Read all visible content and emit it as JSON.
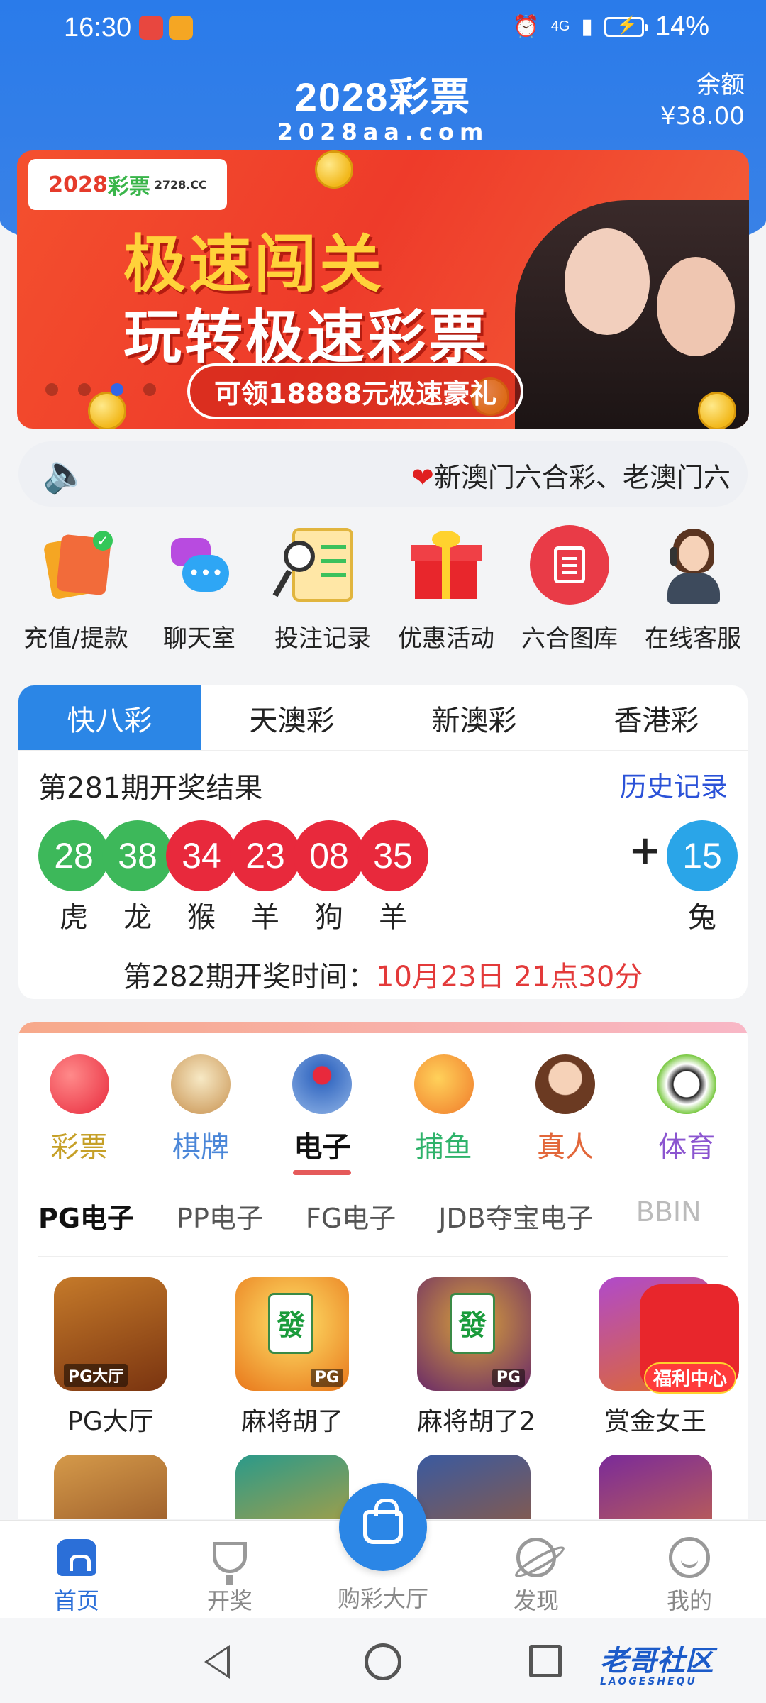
{
  "status_bar": {
    "time": "16:30",
    "network": "4G",
    "battery": "14%"
  },
  "header": {
    "logo": "2028彩票",
    "logo_domain": "2028aa.com",
    "balance_label": "余额",
    "balance_value": "¥38.00"
  },
  "banner": {
    "brand_a": "2028",
    "brand_b": "彩票",
    "brand_domain": "2728.CC",
    "title_line1": "极速闯关",
    "title_line2": "玩转极速彩票",
    "pill": "可领18888元极速豪礼",
    "active_slide": 2,
    "slide_count": 4
  },
  "notice": {
    "icon": "speaker-icon",
    "text": "新澳门六合彩、老澳门六"
  },
  "quick_actions": [
    {
      "label": "充值/提款",
      "icon": "wallet-cards-icon"
    },
    {
      "label": "聊天室",
      "icon": "chat-bubbles-icon"
    },
    {
      "label": "投注记录",
      "icon": "clipboard-search-icon"
    },
    {
      "label": "优惠活动",
      "icon": "gift-box-icon"
    },
    {
      "label": "六合图库",
      "icon": "document-icon"
    },
    {
      "label": "在线客服",
      "icon": "customer-service-icon"
    }
  ],
  "results": {
    "tabs": [
      "快八彩",
      "天澳彩",
      "新澳彩",
      "香港彩"
    ],
    "active_tab": 0,
    "title": "第281期开奖结果",
    "history_link": "历史记录",
    "balls": [
      {
        "number": "28",
        "zodiac": "虎",
        "color": "green"
      },
      {
        "number": "38",
        "zodiac": "龙",
        "color": "green"
      },
      {
        "number": "34",
        "zodiac": "猴",
        "color": "red"
      },
      {
        "number": "23",
        "zodiac": "羊",
        "color": "red"
      },
      {
        "number": "08",
        "zodiac": "狗",
        "color": "red"
      },
      {
        "number": "35",
        "zodiac": "羊",
        "color": "red"
      }
    ],
    "plus": "+",
    "special_ball": {
      "number": "15",
      "zodiac": "兔",
      "color": "blue"
    },
    "next_draw_label": "第282期开奖时间：",
    "next_draw_time": "10月23日 21点30分"
  },
  "games": {
    "categories": [
      {
        "label": "彩票",
        "color": "#c6a028",
        "icon": "lottery-ball-icon"
      },
      {
        "label": "棋牌",
        "color": "#4a86d8",
        "icon": "cards-icon"
      },
      {
        "label": "电子",
        "color": "#111111",
        "icon": "joystick-icon"
      },
      {
        "label": "捕鱼",
        "color": "#2fb36b",
        "icon": "fish-icon"
      },
      {
        "label": "真人",
        "color": "#e2673a",
        "icon": "dealer-icon"
      },
      {
        "label": "体育",
        "color": "#8b55d0",
        "icon": "soccer-ball-icon"
      }
    ],
    "active_category": 2,
    "subtabs": [
      "PG电子",
      "PP电子",
      "FG电子",
      "JDB夺宝电子",
      "BBIN"
    ],
    "active_subtab": 0,
    "tiles": [
      {
        "label": "PG大厅",
        "tag": "PG大厅"
      },
      {
        "label": "麻将胡了",
        "tag": "PG",
        "glyph": "發"
      },
      {
        "label": "麻将胡了2",
        "tag": "PG",
        "glyph": "發"
      },
      {
        "label": "赏金女王"
      }
    ],
    "welfare_label": "福利中心"
  },
  "bottom_nav": {
    "items": [
      "首页",
      "开奖",
      "发现",
      "我的"
    ],
    "center_label": "购彩大厅",
    "active": 0
  },
  "watermark": {
    "text": "老哥社区",
    "sub": "LAOGESHEQU"
  },
  "colors": {
    "primary": "#2b86e6",
    "ball_green": "#3db85a",
    "ball_red": "#e8293c",
    "ball_blue": "#2aa5e8",
    "accent_red": "#e33a3a"
  }
}
